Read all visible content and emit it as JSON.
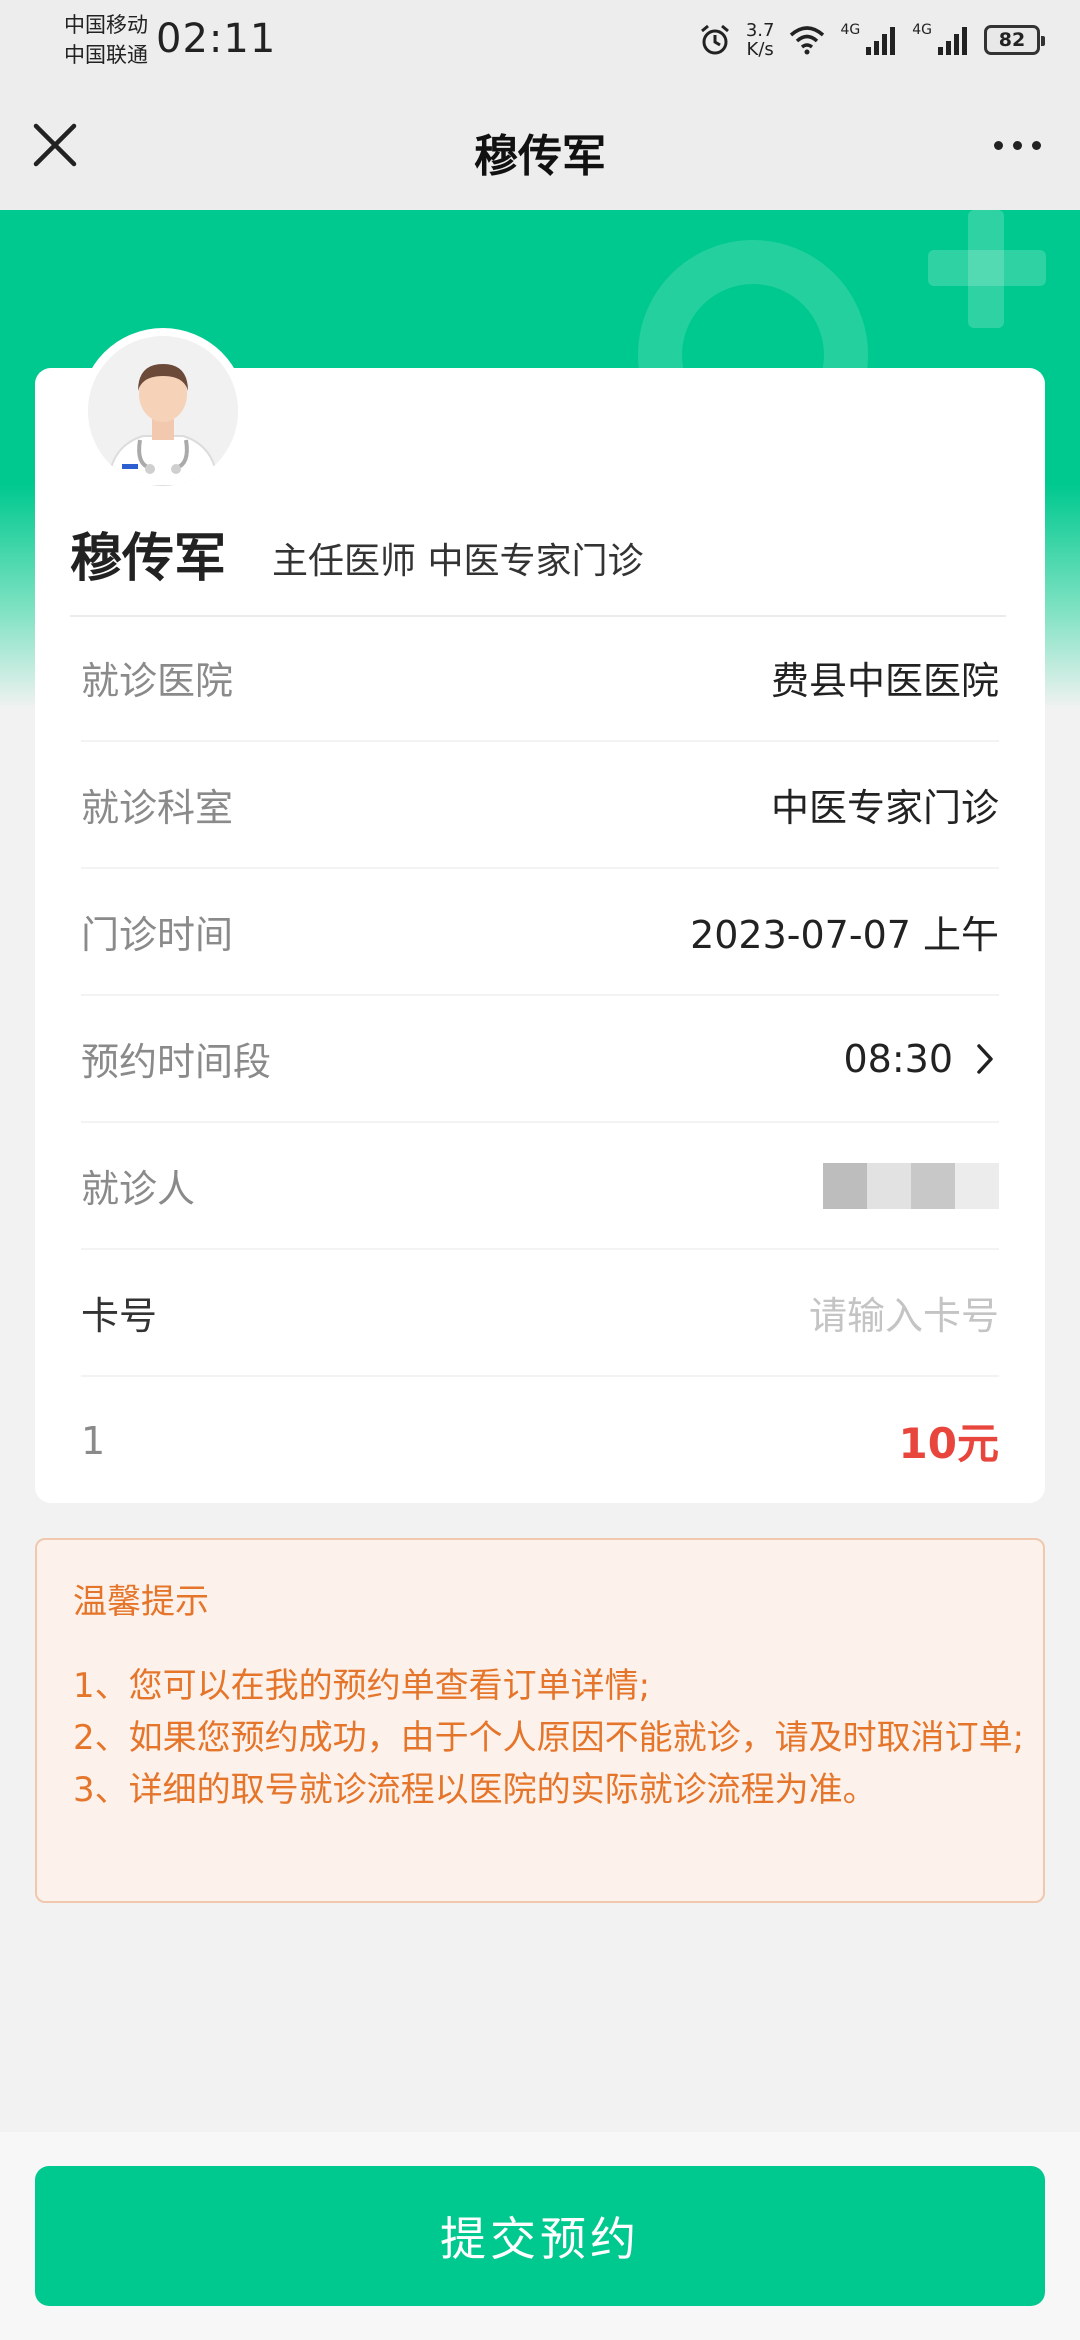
{
  "status_bar": {
    "carrier_1": "中国移动",
    "carrier_2": "中国联通",
    "time": "02:11",
    "speed_value": "3.7",
    "speed_unit": "K/s",
    "signal_label_1": "4G",
    "signal_label_2": "4G",
    "battery": "82"
  },
  "nav": {
    "title": "穆传军"
  },
  "doctor": {
    "name": "穆传军",
    "title": "主任医师 中医专家门诊"
  },
  "rows": [
    {
      "label": "就诊医院",
      "value": "费县中医医院"
    },
    {
      "label": "就诊科室",
      "value": "中医专家门诊"
    },
    {
      "label": "门诊时间",
      "value": "2023-07-07 上午"
    },
    {
      "label": "预约时间段",
      "value": "08:30"
    },
    {
      "label": "就诊人",
      "value": ""
    },
    {
      "label": "卡号",
      "placeholder": "请输入卡号"
    },
    {
      "label": "1",
      "value": "10元"
    }
  ],
  "tips": {
    "title": "温馨提示",
    "lines": [
      "1、您可以在我的预约单查看订单详情;",
      "2、如果您预约成功，由于个人原因不能就诊，请及时取消订单;",
      "3、详细的取号就诊流程以医院的实际就诊流程为准。"
    ]
  },
  "submit_label": "提交预约",
  "colors": {
    "brand_green": "#00c98f",
    "price_red": "#e8453c",
    "tips_orange": "#e5752a"
  }
}
